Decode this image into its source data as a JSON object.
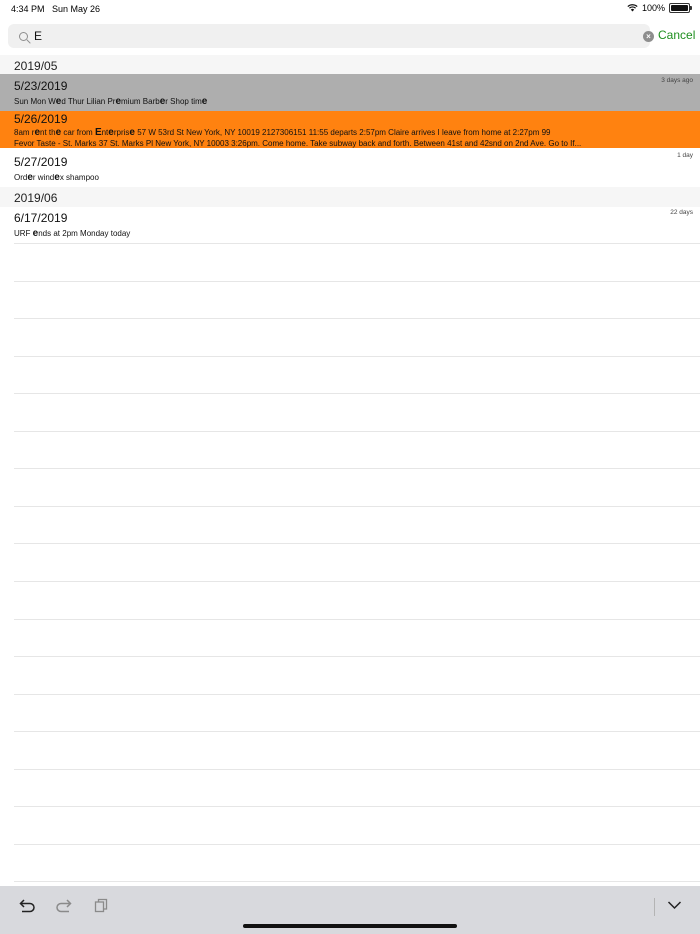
{
  "status_bar": {
    "time": "4:34 PM",
    "date": "Sun May 26",
    "battery": "100%"
  },
  "search": {
    "value": "E",
    "cancel_label": "Cancel"
  },
  "sections": [
    {
      "title": "2019/05"
    },
    {
      "title": "2019/06"
    }
  ],
  "entries": [
    {
      "date": "5/23/2019",
      "ago": "3 days ago",
      "excerpt_parts": [
        "Sun Mon W",
        "e",
        "d Thur Lilian Pr",
        "e",
        "mium Barb",
        "e",
        "r Shop tim",
        "e"
      ],
      "highlight": "gray"
    },
    {
      "date": "5/26/2019",
      "ago": "",
      "excerpt_parts": [
        "8am r",
        "e",
        "nt th",
        "e",
        " car from ",
        "E",
        "nt",
        "e",
        "rpris",
        "e",
        " 57 W 53rd St New York, NY 10019 2127306151  11:55 departs 2:57pm Claire arrives  I leave from home at 2:27pm  99"
      ],
      "excerpt_line2": "Fevor Taste - St. Marks 37 St. Marks Pl New York, NY 10003  3:26pm. Come home. Take subway back and forth. Between 41st and 42snd on 2nd Ave.  Go to If...",
      "highlight": "orange"
    },
    {
      "date": "5/27/2019",
      "ago": "1 day",
      "excerpt_parts": [
        "Ord",
        "e",
        "r wind",
        "e",
        "x shampoo"
      ],
      "highlight": "none"
    },
    {
      "date": "6/17/2019",
      "ago": "22 days",
      "excerpt_parts": [
        "URF ",
        "e",
        "nds at 2pm Monday today"
      ],
      "highlight": "none"
    }
  ],
  "toolbar": {
    "undo_icon": "undo-icon",
    "redo_icon": "redo-icon",
    "copy_icon": "copy-icon",
    "collapse_icon": "chevron-down-icon"
  },
  "colors": {
    "highlight_gray": "#aeaeae",
    "highlight_orange": "#ff8210",
    "accent": "#1e8f1e"
  }
}
